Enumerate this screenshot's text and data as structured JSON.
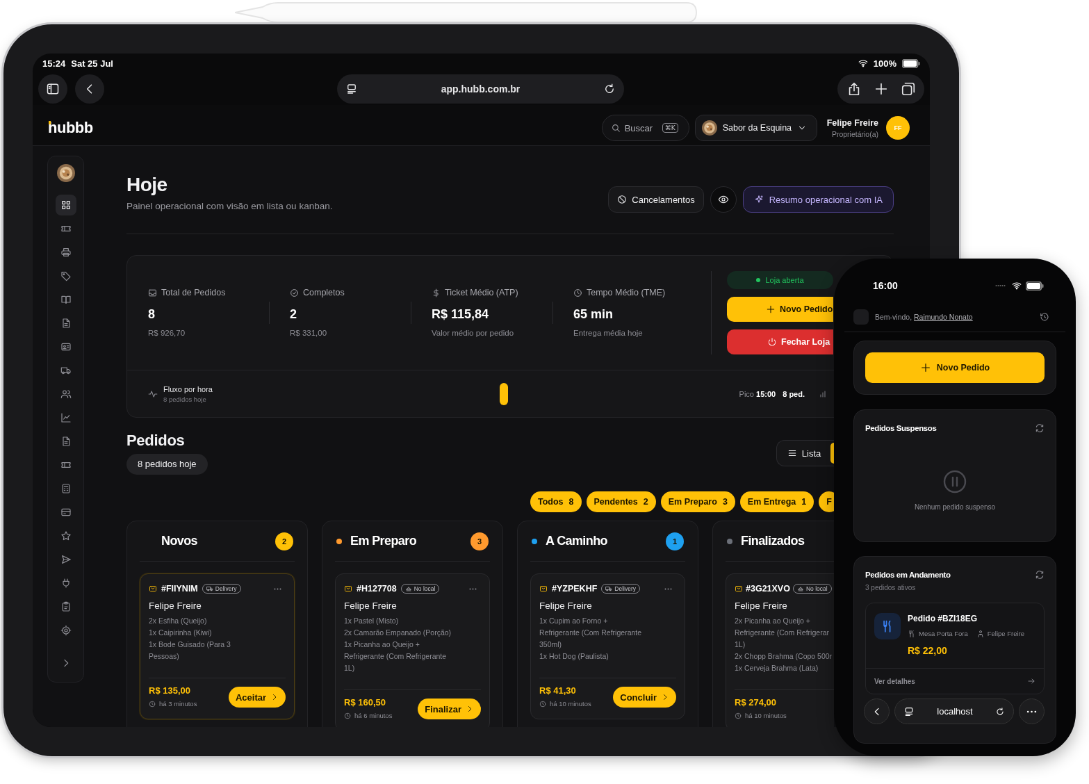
{
  "tablet": {
    "status_bar": {
      "time": "15:24",
      "date": "Sat 25 Jul",
      "battery": "100%"
    },
    "browser": {
      "url": "app.hubb.com.br"
    },
    "header": {
      "logo": "hubbb",
      "search": {
        "placeholder": "Buscar",
        "shortcut": "⌘K"
      },
      "store": "Sabor da Esquina",
      "user": {
        "name": "Felipe Freire",
        "role": "Proprietário(a)",
        "initials": "FF"
      }
    },
    "sidebar": {
      "items": [
        {
          "selected": true
        },
        {
          "selected": false
        },
        {
          "selected": false
        },
        {
          "selected": false
        },
        {
          "selected": false
        },
        {
          "selected": false
        },
        {
          "selected": false
        },
        {
          "selected": false
        },
        {
          "selected": false
        },
        {
          "selected": false
        },
        {
          "selected": false
        },
        {
          "selected": false
        },
        {
          "selected": false
        },
        {
          "selected": false
        },
        {
          "selected": false
        },
        {
          "selected": false
        },
        {
          "selected": false
        },
        {
          "selected": false
        },
        {
          "selected": false
        }
      ]
    },
    "page": {
      "title": "Hoje",
      "subtitle": "Painel operacional com visão em lista ou kanban.",
      "cancellations": "Cancelamentos",
      "ai_summary": "Resumo operacional com IA"
    },
    "stats": [
      {
        "label": "Total de Pedidos",
        "value": "8",
        "sub": "R$ 926,70"
      },
      {
        "label": "Completos",
        "value": "2",
        "sub": "R$ 331,00"
      },
      {
        "label": "Ticket Médio (ATP)",
        "value": "R$ 115,84",
        "sub": "Valor médio por pedido"
      },
      {
        "label": "Tempo Médio (TME)",
        "value": "65 min",
        "sub": "Entrega média hoje"
      }
    ],
    "store_panel": {
      "status": "Loja aberta",
      "open": true,
      "new_order": "Novo Pedido",
      "close_store": "Fechar Loja"
    },
    "flow": {
      "title": "Fluxo por hora",
      "sub": "8 pedidos hoje",
      "peak": "Pico **15:00**",
      "peak_count": "8 ped."
    },
    "orders": {
      "title": "Pedidos",
      "badge": "8 pedidos hoje",
      "views": [
        {
          "label": "Lista",
          "selected": false
        },
        {
          "selected": true
        }
      ],
      "filters": [
        {
          "label": "Todos",
          "count": "8"
        },
        {
          "label": "Pendentes",
          "count": "2"
        },
        {
          "label": "Em Preparo",
          "count": "3"
        },
        {
          "label": "Em Entrega",
          "count": "1"
        },
        {
          "label": "F"
        }
      ],
      "columns": [
        {
          "title": "Novos",
          "count": "2",
          "color": "#ffc107",
          "dot": false,
          "cards": [
            {
              "id": "#FIIYNIM",
              "kind": "delivery",
              "type": "Delivery",
              "customer": "Felipe Freire",
              "items": [
                "2x Esfiha (Queijo)",
                "1x Caipirinha (Kiwi)",
                "1x Bode Guisado (Para 3\nPessoas)"
              ],
              "price": "R$ 135,00",
              "time": "há 3 minutos",
              "action": "Aceitar",
              "highlighted": true
            }
          ]
        },
        {
          "title": "Em Preparo",
          "count": "3",
          "color": "#ff9a2e",
          "dot": true,
          "cards": [
            {
              "id": "#H127708",
              "kind": "dine_in",
              "type": "No local",
              "customer": "Felipe Freire",
              "items": [
                "1x Pastel (Misto)",
                "2x Camarão Empanado (Porção)",
                "1x Picanha ao Queijo +\nRefrigerante (Com Refrigerante\n1L)"
              ],
              "price": "R$ 160,50",
              "time": "há 6 minutos",
              "action": "Finalizar",
              "highlighted": false
            }
          ]
        },
        {
          "title": "A Caminho",
          "count": "1",
          "color": "#1ea0f0",
          "dot": true,
          "cards": [
            {
              "id": "#YZPEKHF",
              "kind": "delivery",
              "type": "Delivery",
              "customer": "Felipe Freire",
              "items": [
                "1x Cupim ao Forno +\nRefrigerante (Com Refrigerante\n350ml)",
                "1x Hot Dog (Paulista)"
              ],
              "price": "R$ 41,30",
              "time": "há 10 minutos",
              "action": "Concluir",
              "highlighted": false
            }
          ]
        },
        {
          "title": "Finalizados",
          "color": "#6b6f78",
          "dot": true,
          "cards": [
            {
              "id": "#3G21XVO",
              "kind": "dine_in",
              "type": "No local",
              "customer": "Felipe Freire",
              "items": [
                "2x Picanha ao Queijo +\nRefrigerante (Com Refrigerar\n1L)",
                "2x Chopp Brahma (Copo 500r",
                "1x Cerveja Brahma (Lata)"
              ],
              "price": "R$ 274,00",
              "time": "há 10 minutos",
              "highlighted": false
            }
          ]
        }
      ]
    }
  },
  "phone": {
    "status_bar": {
      "time": "16:00"
    },
    "greeting": "Bem-vindo,",
    "user": "Raimundo Nonato",
    "new_order": "Novo Pedido",
    "suspended": {
      "title": "Pedidos Suspensos",
      "empty": "Nenhum pedido suspenso"
    },
    "in_progress": {
      "title": "Pedidos em Andamento",
      "sub": "3 pedidos ativos",
      "orders": [
        {
          "title": "Pedido #BZI18EG",
          "table": "Mesa Porta Fora",
          "customer": "Felipe Freire",
          "price": "R$ 22,00",
          "link": "Ver detalhes"
        }
      ]
    },
    "browser": {
      "url": "localhost"
    }
  }
}
